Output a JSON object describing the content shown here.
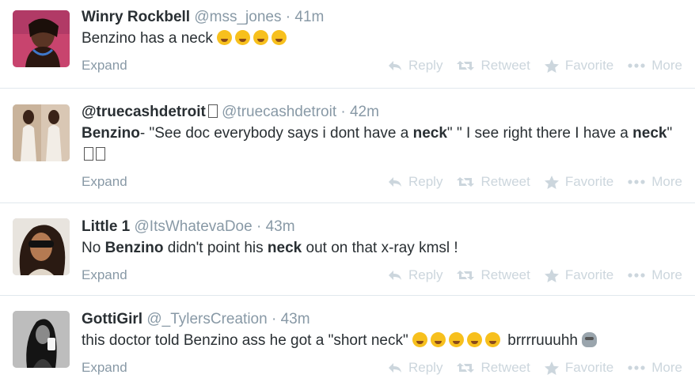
{
  "tweets": [
    {
      "fullname": "Winry Rockbell",
      "username": "@mss_jones",
      "sep": "·",
      "time": "41m",
      "text_parts": [
        "Benzino has a neck "
      ],
      "emojis": [
        "weary-face",
        "weary-face",
        "weary-face",
        "weary-face"
      ]
    },
    {
      "fullname": "@truecashdetroit",
      "username": "@truecashdetroit",
      "sep": "·",
      "time": "42m",
      "text_a": "Benzino",
      "text_b": "- \"See doc everybody says i dont have a ",
      "text_c": "neck",
      "text_d": "\" \" I see right there I have a ",
      "text_e": "neck",
      "text_f": "\""
    },
    {
      "fullname": "Little 1",
      "username": "@ItsWhatevaDoe",
      "sep": "·",
      "time": "43m",
      "text_a": "No ",
      "text_b": "Benzino",
      "text_c": " didn't point his ",
      "text_d": "neck",
      "text_e": " out on that x-ray kmsl !"
    },
    {
      "fullname": "GottiGirl",
      "username": "@_TylersCreation",
      "sep": "·",
      "time": "43m",
      "text_a": "this doctor told Benzino ass he got a \"short neck\" ",
      "text_b": " brrrruuuhh "
    }
  ],
  "footer": {
    "expand": "Expand",
    "reply": "Reply",
    "retweet": "Retweet",
    "favorite": "Favorite",
    "more": "More"
  },
  "icons": {
    "reply": "reply-icon",
    "retweet": "retweet-icon",
    "favorite": "star-icon",
    "more": "ellipsis-icon"
  },
  "colors": {
    "name": "#292f33",
    "meta": "#8899a6",
    "action": "#ccd6dd",
    "divider": "#e1e8ed"
  }
}
